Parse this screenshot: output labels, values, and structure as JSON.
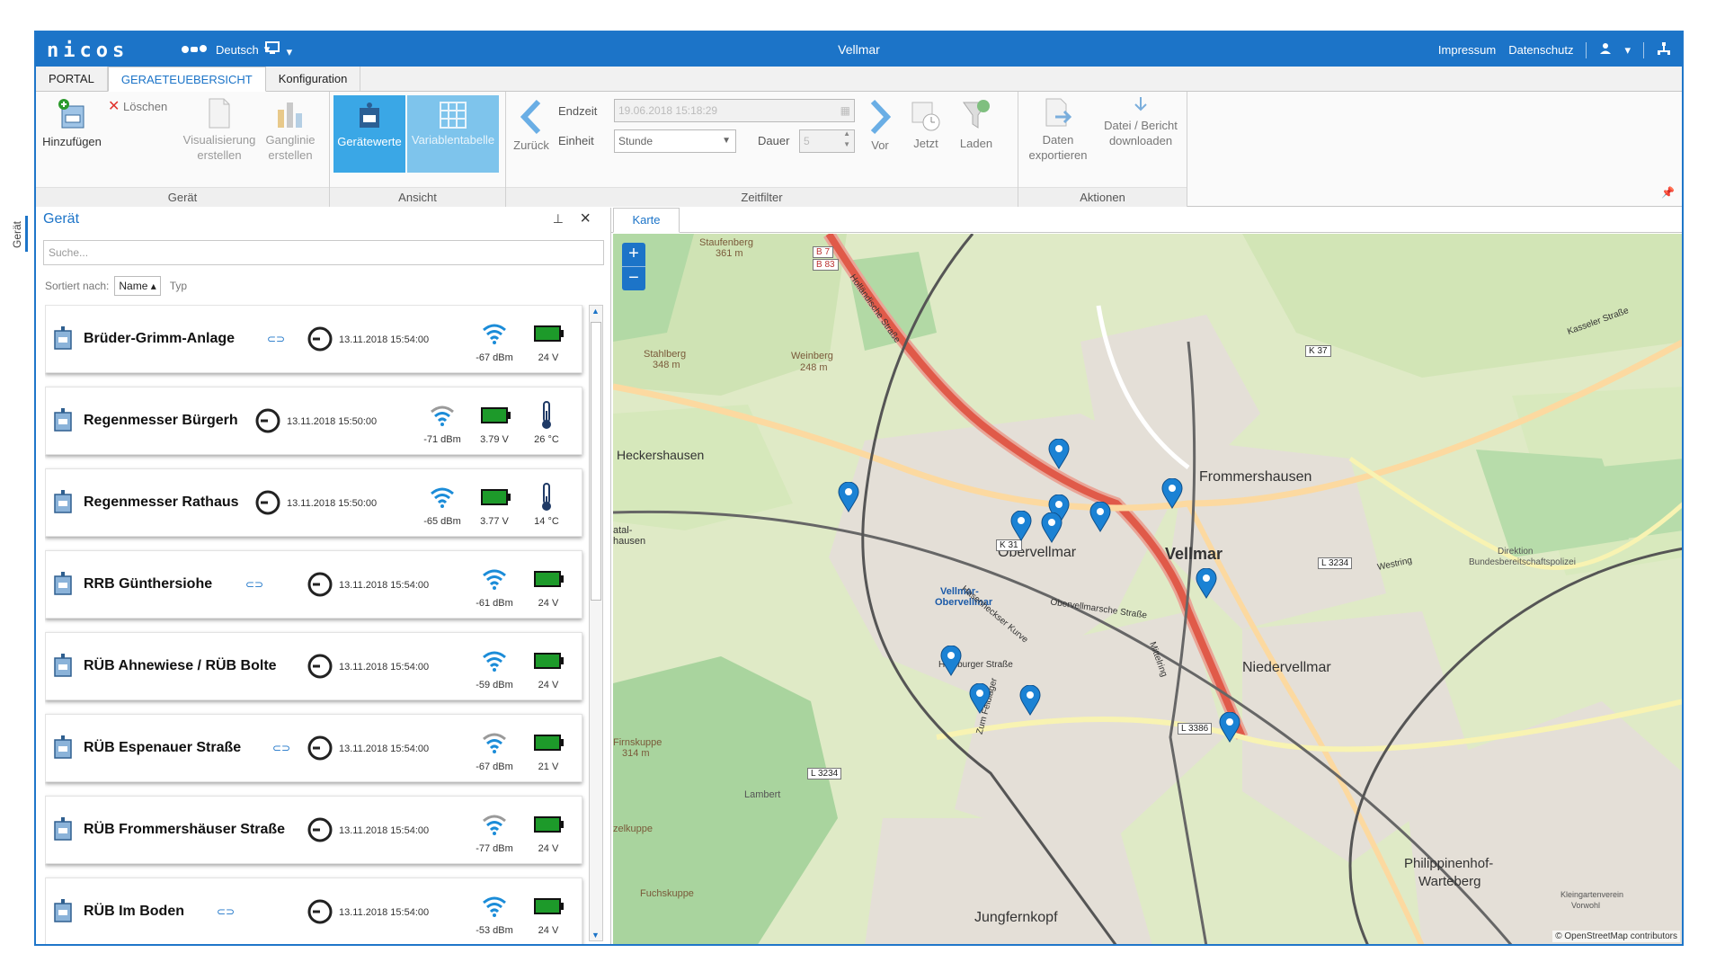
{
  "header": {
    "logo": "nicos",
    "language": "Deutsch",
    "title": "Vellmar",
    "links": [
      "Impressum",
      "Datenschutz"
    ]
  },
  "tabs": [
    {
      "label": "PORTAL"
    },
    {
      "label": "GERAETEUEBERSICHT"
    },
    {
      "label": "Konfiguration"
    }
  ],
  "ribbon": {
    "geraet": {
      "label": "Gerät",
      "add": "Hinzufügen",
      "delete": "Löschen",
      "visualize": [
        "Visualisierung",
        "erstellen"
      ],
      "ganglinie": [
        "Ganglinie",
        "erstellen"
      ]
    },
    "ansicht": {
      "label": "Ansicht",
      "geraetewerte": "Gerätewerte",
      "variablentabelle": "Variablentabelle"
    },
    "zeitfilter": {
      "label": "Zeitfilter",
      "back": "Zurück",
      "endzeit_label": "Endzeit",
      "endzeit_value": "19.06.2018 15:18:29",
      "einheit_label": "Einheit",
      "einheit_value": "Stunde",
      "dauer_label": "Dauer",
      "dauer_value": "5",
      "forward": "Vor",
      "now": "Jetzt",
      "load": "Laden"
    },
    "aktionen": {
      "label": "Aktionen",
      "export": [
        "Daten",
        "exportieren"
      ],
      "download": [
        "Datei / Bericht",
        "downloaden"
      ]
    }
  },
  "sidetab": "Gerät",
  "device_panel": {
    "title": "Gerät",
    "search_placeholder": "Suche...",
    "sort_label": "Sortiert nach:",
    "sort_value": "Name ▴",
    "sort_alt": "Typ"
  },
  "devices": [
    {
      "name": "Brüder-Grimm-Anlage",
      "time": "13.11.2018 15:54:00",
      "signal": "-67 dBm",
      "battery": "24 V"
    },
    {
      "name": "Regenmesser Bürgerh",
      "time": "13.11.2018 15:50:00",
      "signal": "-71 dBm",
      "battery": "3.79 V",
      "temp": "26 °C"
    },
    {
      "name": "Regenmesser Rathaus",
      "time": "13.11.2018 15:50:00",
      "signal": "-65 dBm",
      "battery": "3.77 V",
      "temp": "14 °C"
    },
    {
      "name": "RRB Günthersiohe",
      "time": "13.11.2018 15:54:00",
      "signal": "-61 dBm",
      "battery": "24 V"
    },
    {
      "name": "RÜB Ahnewiese / RÜB Bolte",
      "time": "13.11.2018 15:54:00",
      "signal": "-59 dBm",
      "battery": "24 V"
    },
    {
      "name": "RÜB Espenauer Straße",
      "time": "13.11.2018 15:54:00",
      "signal": "-67 dBm",
      "battery": "21 V"
    },
    {
      "name": "RÜB Frommershäuser Straße",
      "time": "13.11.2018 15:54:00",
      "signal": "-77 dBm",
      "battery": "24 V"
    },
    {
      "name": "RÜB Im Boden",
      "time": "13.11.2018 15:54:00",
      "signal": "-53 dBm",
      "battery": "24 V"
    }
  ],
  "map": {
    "tab": "Karte",
    "zoom_in": "+",
    "zoom_out": "−",
    "places": [
      "Vellmar",
      "Frommershausen",
      "Obervellmar",
      "Niedervellmar",
      "Heckershausen",
      "Jungfernkopf",
      "Philippinenhof-",
      "Warteberg",
      "Weinberg",
      "248 m",
      "Stahlberg",
      "348 m",
      "Staufenberg",
      "361 m",
      "Vellmar-",
      "Obervellmar",
      "Lambert",
      "Direktion",
      "Bundesbereitschaftspolizei",
      "atal-",
      "hausen",
      "Firnskuppe",
      "314 m",
      "Fuchskuppe",
      "zelkuppe",
      "Kleingartenverein",
      "Vorwohl"
    ],
    "roads": [
      "B 7",
      "B 83",
      "K 37",
      "K 31",
      "L 3234",
      "L 3234",
      "L 3386"
    ],
    "streets": [
      "Holländische Straße",
      "Kasseler Straße",
      "Obervellmarsche Straße",
      "Hamburger Straße",
      "Westring",
      "Zum Feldlager",
      "Hasenheckser Kurve",
      "Mittelring"
    ],
    "copyright": "© OpenStreetMap contributors"
  },
  "colors": {
    "accent": "#1c74c8",
    "active": "#3aa7e6",
    "marker": "#1b82d4",
    "battery": "#1d9a2a"
  }
}
